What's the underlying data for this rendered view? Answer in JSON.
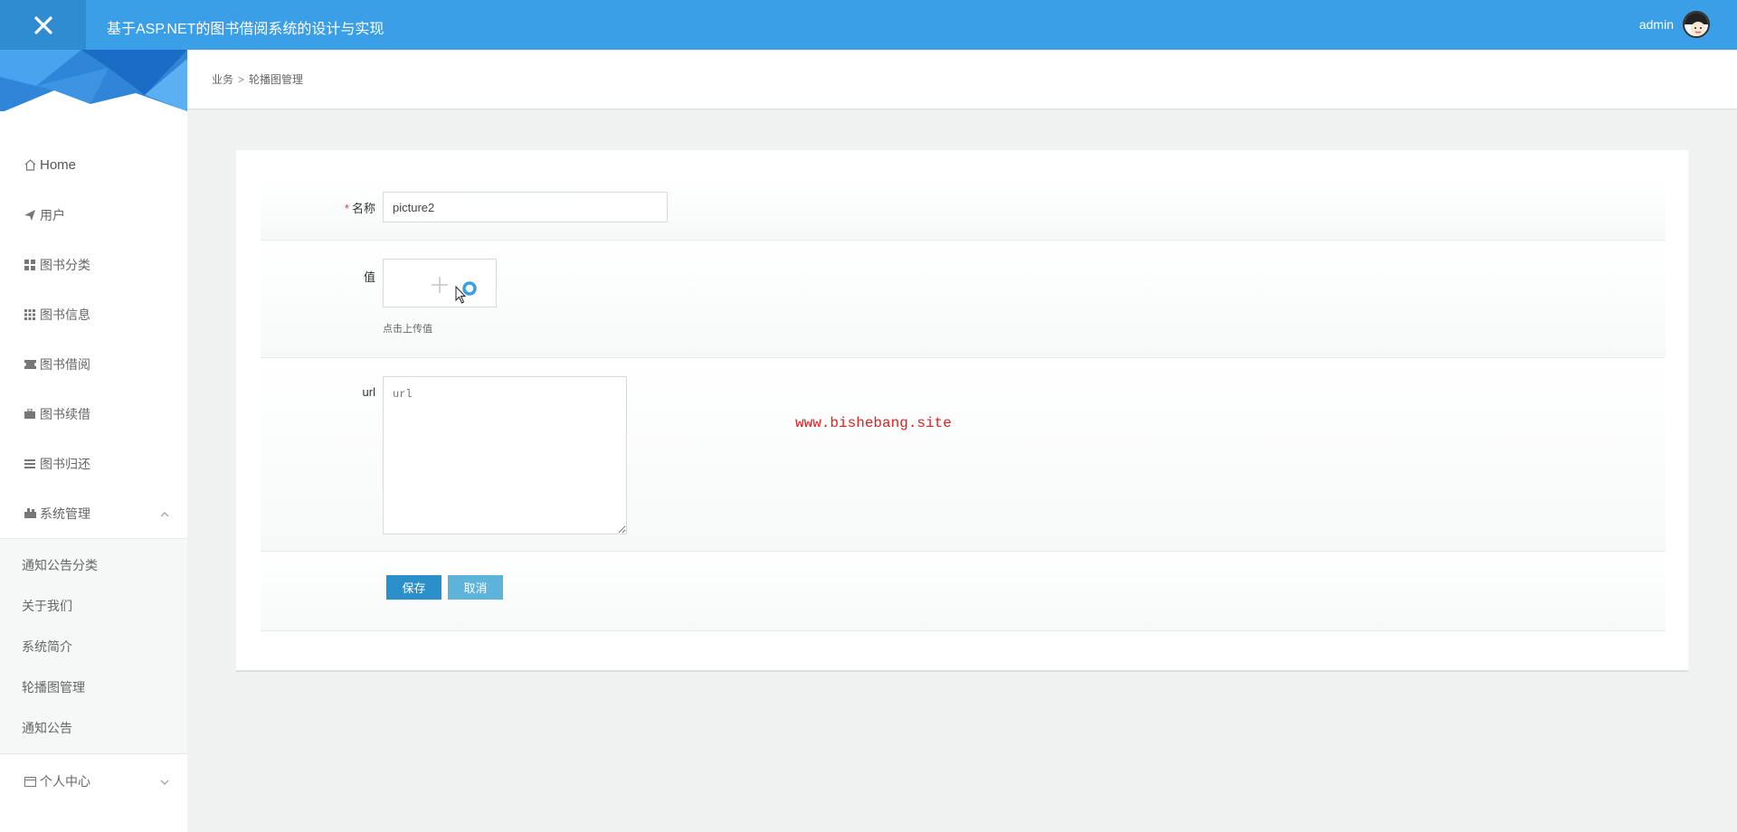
{
  "header": {
    "app_title": "基于ASP.NET的图书借阅系统的设计与实现",
    "username": "admin",
    "close_icon": "close-icon"
  },
  "sidebar": {
    "items": [
      {
        "label": "Home",
        "icon": "home-icon"
      },
      {
        "label": "用户",
        "icon": "paper-plane-icon"
      },
      {
        "label": "图书分类",
        "icon": "grid-icon"
      },
      {
        "label": "图书信息",
        "icon": "grid-small-icon"
      },
      {
        "label": "图书借阅",
        "icon": "ticket-icon"
      },
      {
        "label": "图书续借",
        "icon": "briefcase-icon"
      },
      {
        "label": "图书归还",
        "icon": "list-icon"
      },
      {
        "label": "系统管理",
        "icon": "settings-icon",
        "expanded": true
      }
    ],
    "system_submenu": [
      "通知公告分类",
      "关于我们",
      "系统简介",
      "轮播图管理",
      "通知公告"
    ],
    "personal": {
      "label": "个人中心",
      "icon": "card-icon",
      "expanded": false
    }
  },
  "breadcrumb": {
    "parent": "业务",
    "separator": ">",
    "current": "轮播图管理"
  },
  "form": {
    "name_label": "名称",
    "name_required_mark": "*",
    "name_value": "picture2",
    "value_label": "值",
    "upload_hint": "点击上传值",
    "url_label": "url",
    "url_placeholder": "url",
    "save_label": "保存",
    "cancel_label": "取消"
  },
  "watermark": "www.bishebang.site",
  "colors": {
    "topbar": "#3a9fe6",
    "save_button": "#2b8fc9",
    "cancel_button": "#5eb3db",
    "watermark": "#e02020"
  }
}
